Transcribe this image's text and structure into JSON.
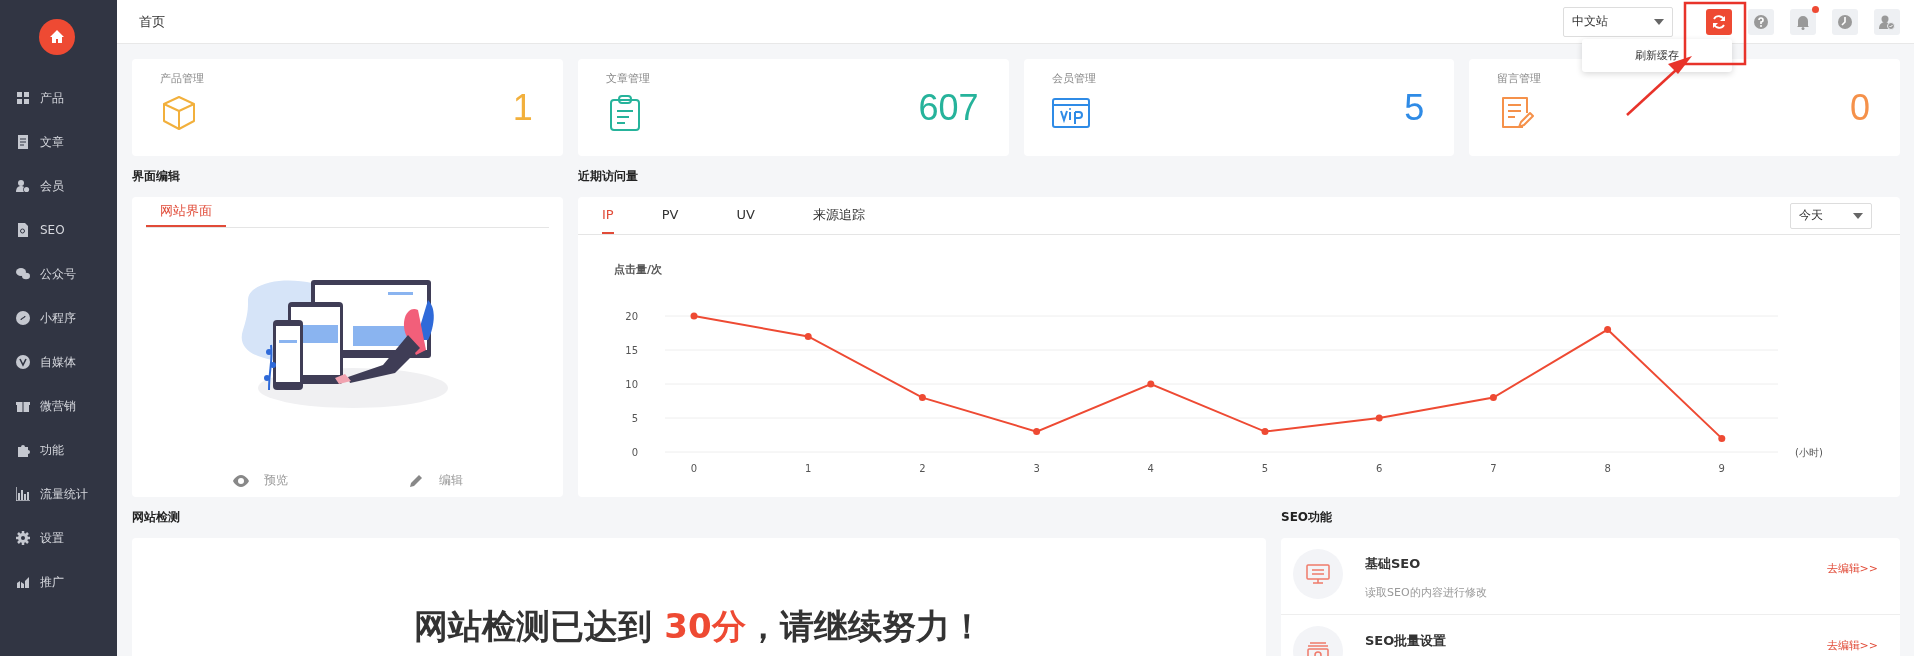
{
  "sidebar": {
    "items": [
      {
        "label": "产品"
      },
      {
        "label": "文章"
      },
      {
        "label": "会员"
      },
      {
        "label": "SEO"
      },
      {
        "label": "公众号"
      },
      {
        "label": "小程序"
      },
      {
        "label": "自媒体"
      },
      {
        "label": "微营销"
      },
      {
        "label": "功能"
      },
      {
        "label": "流量统计"
      },
      {
        "label": "设置"
      },
      {
        "label": "推广"
      }
    ]
  },
  "header": {
    "title": "首页",
    "site_select": {
      "value": "中文站"
    },
    "refresh_tooltip": "刷新缓存"
  },
  "stats": [
    {
      "label": "产品管理",
      "value": "1",
      "color": "#f2b03c"
    },
    {
      "label": "文章管理",
      "value": "607",
      "color": "#26b39b"
    },
    {
      "label": "会员管理",
      "value": "5",
      "color": "#2f8be6"
    },
    {
      "label": "留言管理",
      "value": "0",
      "color": "#f5914a"
    }
  ],
  "interface_edit": {
    "title": "界面编辑",
    "tabs": [
      {
        "label": "网站界面",
        "selected": true
      }
    ],
    "actions": [
      {
        "label": "预览"
      },
      {
        "label": "编辑"
      }
    ]
  },
  "visits": {
    "title": "近期访问量",
    "tabs": [
      {
        "label": "IP",
        "selected": true
      },
      {
        "label": "PV",
        "selected": false
      },
      {
        "label": "UV",
        "selected": false
      },
      {
        "label": "来源追踪",
        "selected": false
      }
    ],
    "range_select": {
      "value": "今天"
    },
    "chart_data": {
      "type": "line",
      "grid": true,
      "ylabel": "点击量/次",
      "xlabel": "(小时)",
      "categories": [
        "0",
        "1",
        "2",
        "3",
        "4",
        "5",
        "6",
        "7",
        "8",
        "9"
      ],
      "series": [
        {
          "color": "#ee4a33",
          "marker": true,
          "values": [
            20,
            17,
            8,
            3,
            10,
            3,
            5,
            8,
            18,
            2
          ]
        }
      ],
      "ylim": [
        0,
        20
      ],
      "yticks": [
        0,
        5,
        10,
        15,
        20
      ]
    }
  },
  "site_check": {
    "title": "网站检测",
    "message_parts": [
      {
        "text": "网站检测已达到 ",
        "highlight": false
      },
      {
        "text": "30分",
        "highlight": true
      },
      {
        "text": "，请继续努力！",
        "highlight": false
      }
    ]
  },
  "seo": {
    "title": "SEO功能",
    "items": [
      {
        "title": "基础SEO",
        "description": "读取SEO的内容进行修改",
        "link": "去编辑>>"
      },
      {
        "title": "SEO批量设置",
        "link": "去编辑>>"
      }
    ]
  }
}
